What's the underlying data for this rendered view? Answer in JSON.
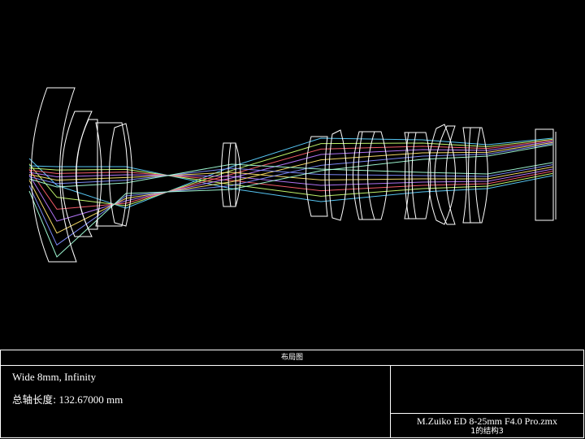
{
  "diagram": {
    "background": "#000000",
    "lens_color": "#ffffff",
    "ray_colors": [
      "#5bd0ff",
      "#c9ff70",
      "#ff5f6e",
      "#b778ff",
      "#ffe36a",
      "#7f8dff",
      "#a2ffd8"
    ]
  },
  "title_block": {
    "header": "布局图",
    "config_line": "Wide 8mm, Infinity",
    "length_label": "总轴长度:",
    "length_value": "132.67000 mm",
    "file_name": "M.Zuiko ED 8-25mm F4.0 Pro.zmx",
    "config_index": "1的结构3"
  }
}
